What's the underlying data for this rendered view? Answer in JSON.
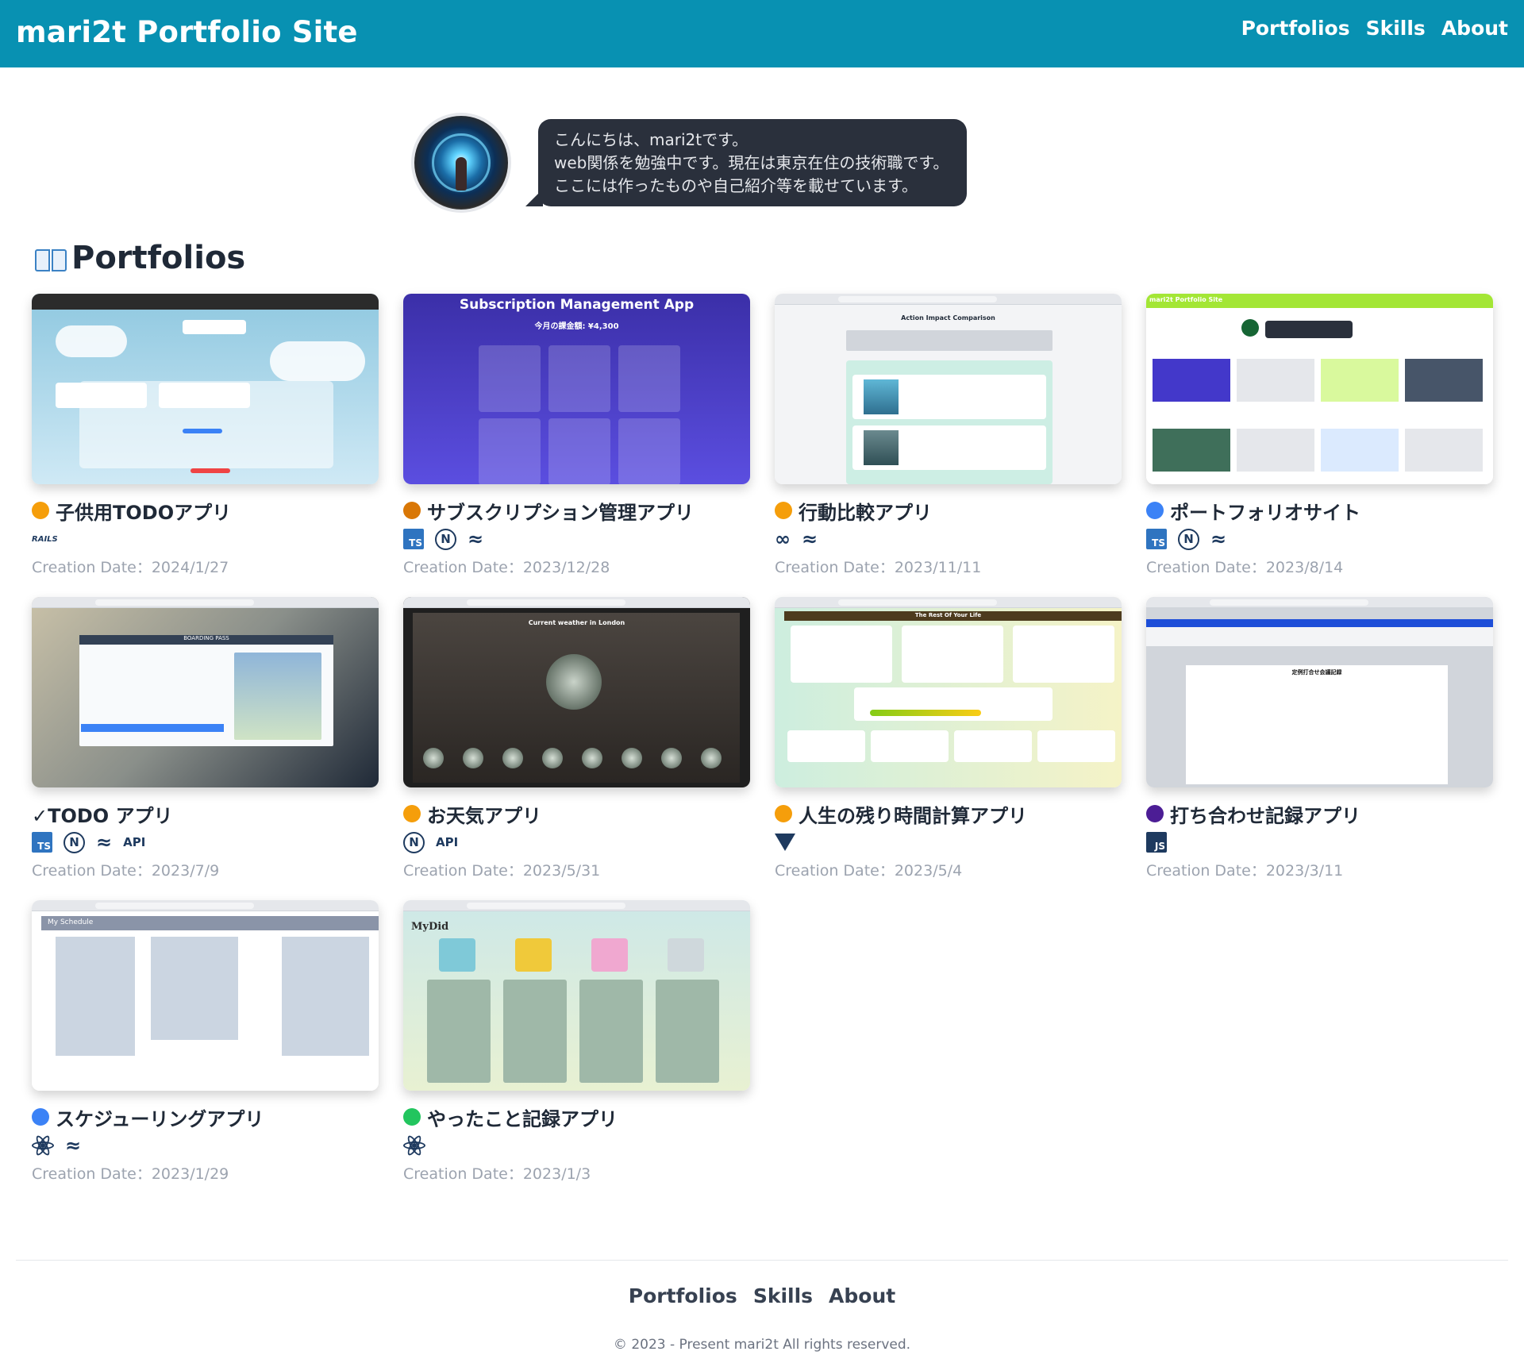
{
  "header": {
    "title": "mari2t Portfolio Site",
    "nav": [
      "Portfolios",
      "Skills",
      "About"
    ]
  },
  "intro": {
    "lines": [
      "こんにちは、mari2tです。",
      "web関係を勉強中です。現在は東京在住の技術職です。",
      "ここには作ったものや自己紹介等を載せています。"
    ]
  },
  "portfolios": {
    "heading": "Portfolios",
    "heading_icon": "open-book-icon",
    "date_prefix": "Creation Date：",
    "items": [
      {
        "title": "子供用TODOアプリ",
        "icon": "child-face-emoji",
        "icon_color": "#f59e0b",
        "tech": [
          "rails"
        ],
        "date": "2024/1/27",
        "thumb": "clouds"
      },
      {
        "title": "サブスクリプション管理アプリ",
        "icon": "money-bag-emoji",
        "icon_color": "#d97706",
        "tech": [
          "typescript",
          "nextjs",
          "tailwind"
        ],
        "date": "2023/12/28",
        "thumb": "subscription",
        "thumb_heading": "Subscription Management App",
        "thumb_sub": "今月の課金額: ¥4,300"
      },
      {
        "title": "行動比較アプリ",
        "icon": "walking-person-emoji",
        "icon_color": "#f59e0b",
        "tech": [
          "link",
          "tailwind"
        ],
        "date": "2023/11/11",
        "thumb": "action",
        "thumb_heading": "Action Impact Comparison"
      },
      {
        "title": "ポートフォリオサイト",
        "icon": "open-book-emoji",
        "icon_color": "#3b82f6",
        "tech": [
          "typescript",
          "nextjs",
          "tailwind"
        ],
        "date": "2023/8/14",
        "thumb": "portfolio",
        "thumb_heading": "mari2t Portfolio Site"
      },
      {
        "title": "✓TODO アプリ",
        "icon": "",
        "icon_color": "",
        "tech": [
          "typescript",
          "nextjs",
          "tailwind",
          "api"
        ],
        "date": "2023/7/9",
        "thumb": "airport",
        "thumb_heading": "BOARDING PASS"
      },
      {
        "title": "お天気アプリ",
        "icon": "sun-face-emoji",
        "icon_color": "#f59e0b",
        "tech": [
          "nextjs",
          "api"
        ],
        "date": "2023/5/31",
        "thumb": "weather",
        "thumb_heading": "Current weather in London"
      },
      {
        "title": "人生の残り時間計算アプリ",
        "icon": "old-man-emoji",
        "icon_color": "#f59e0b",
        "tech": [
          "vue"
        ],
        "date": "2023/5/4",
        "thumb": "life",
        "thumb_heading": "The Rest Of Your Life"
      },
      {
        "title": "打ち合わせ記録アプリ",
        "icon": "speaking-head-emoji",
        "icon_color": "#4c1d95",
        "tech": [
          "javascript"
        ],
        "date": "2023/3/11",
        "thumb": "meeting",
        "thumb_heading": "定例打合せ会議記録"
      },
      {
        "title": "スケジューリングアプリ",
        "icon": "calendar-emoji",
        "icon_color": "#3b82f6",
        "tech": [
          "react",
          "tailwind"
        ],
        "date": "2023/1/29",
        "thumb": "schedule",
        "thumb_heading": "My Schedule"
      },
      {
        "title": "やったこと記録アプリ",
        "icon": "check-mark-emoji",
        "icon_color": "#22c55e",
        "tech": [
          "react"
        ],
        "date": "2023/1/3",
        "thumb": "mydid",
        "thumb_heading": "MyDid"
      }
    ]
  },
  "tech_labels": {
    "typescript": "TS",
    "javascript": "JS",
    "nextjs": "N",
    "tailwind": "≈",
    "api": "API",
    "rails": "RAILS",
    "link": "∞"
  },
  "footer": {
    "nav": [
      "Portfolios",
      "Skills",
      "About"
    ],
    "copyright": "© 2023 - Present mari2t All rights reserved."
  }
}
